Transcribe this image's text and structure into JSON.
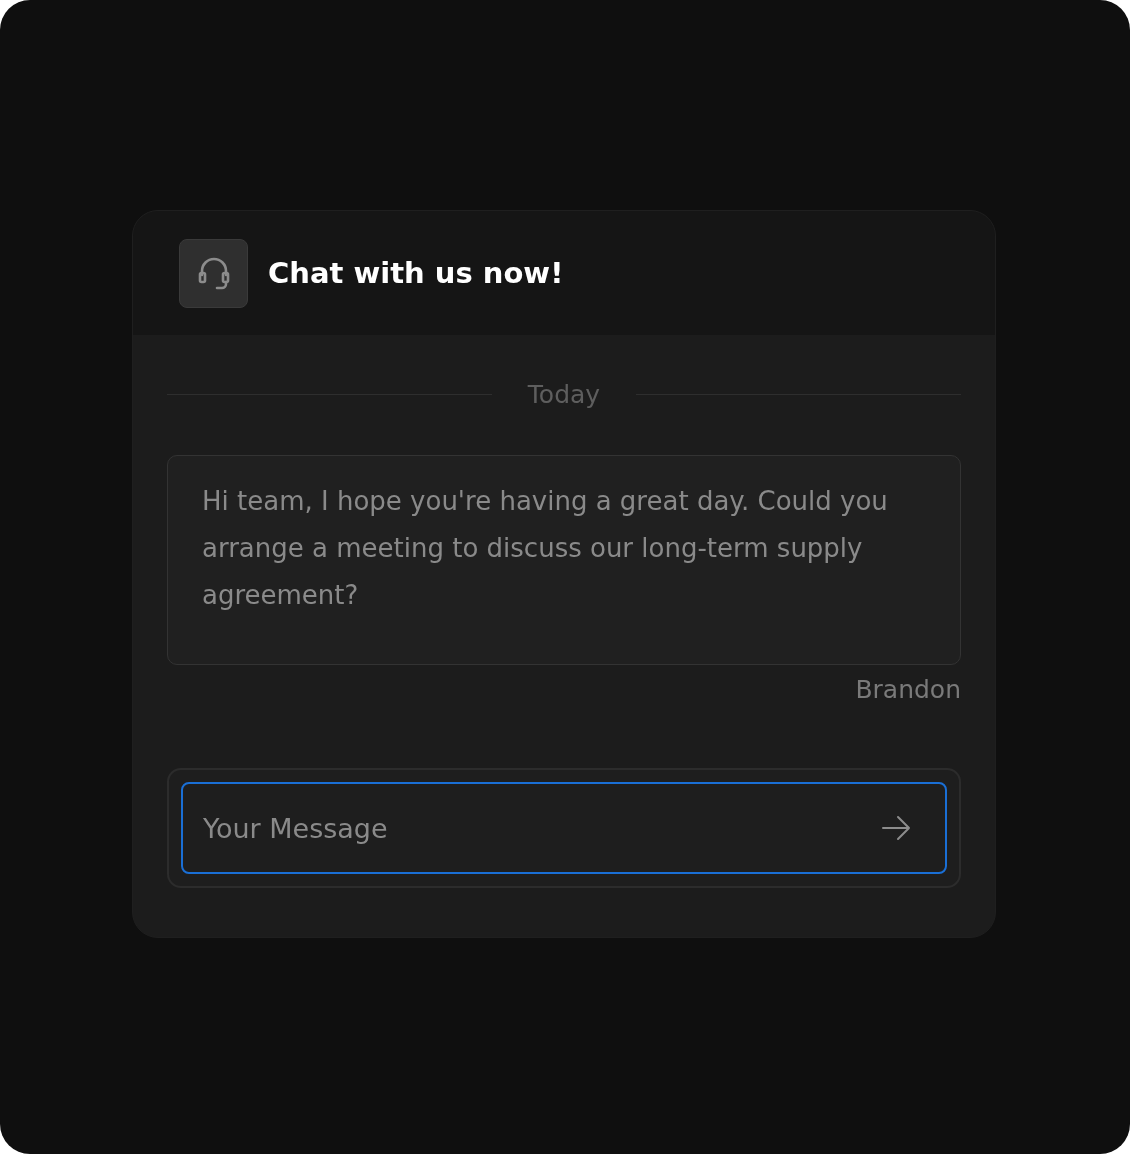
{
  "chat": {
    "title": "Chat with us now!"
  },
  "divider": {
    "label": "Today"
  },
  "messages": [
    {
      "text": "Hi team, I hope you're having a great day. Could you arrange a meeting to discuss our long-term supply agreement?",
      "author": "Brandon"
    }
  ],
  "composer": {
    "placeholder": "Your Message",
    "focused": true
  }
}
